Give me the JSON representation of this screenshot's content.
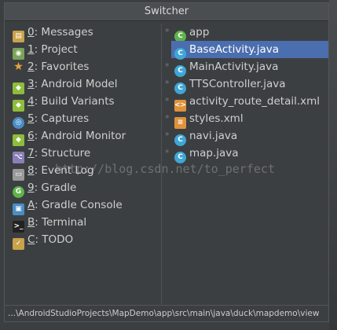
{
  "window": {
    "title": "Switcher"
  },
  "tool_windows": [
    {
      "key": "0",
      "label": ": Messages",
      "icon": "messages-icon",
      "color": "#c9a24a"
    },
    {
      "key": "1",
      "label": ": Project",
      "icon": "project-icon",
      "color": "#7aa35a"
    },
    {
      "key": "2",
      "label": ": Favorites",
      "icon": "star-icon",
      "color": "#e8a33d"
    },
    {
      "key": "3",
      "label": ": Android Model",
      "icon": "android-icon",
      "color": "#8dbd3a"
    },
    {
      "key": "4",
      "label": ": Build Variants",
      "icon": "android-icon",
      "color": "#8dbd3a"
    },
    {
      "key": "5",
      "label": ": Captures",
      "icon": "captures-icon",
      "color": "#4a8dc4"
    },
    {
      "key": "6",
      "label": ": Android Monitor",
      "icon": "android-icon",
      "color": "#8dbd3a"
    },
    {
      "key": "7",
      "label": ": Structure",
      "icon": "structure-icon",
      "color": "#8a7fb8"
    },
    {
      "key": "8",
      "label": ": Event Log",
      "icon": "event-log-icon",
      "color": "#9a9a9a"
    },
    {
      "key": "9",
      "label": ": Gradle",
      "icon": "gradle-icon",
      "color": "#5fb34a"
    },
    {
      "key": "A",
      "label": ": Gradle Console",
      "icon": "gradle-console-icon",
      "color": "#4a8dc4"
    },
    {
      "key": "B",
      "label": ": Terminal",
      "icon": "terminal-icon",
      "color": "#222222"
    },
    {
      "key": "C",
      "label": ": TODO",
      "icon": "todo-icon",
      "color": "#c9a24a"
    }
  ],
  "files": [
    {
      "name": "app",
      "icon": "app-module-icon",
      "color": "#5fb34a"
    },
    {
      "name": "BaseActivity.java",
      "icon": "java-class-icon",
      "color": "#3fa7d6",
      "selected": true
    },
    {
      "name": "MainActivity.java",
      "icon": "java-class-icon",
      "color": "#3fa7d6"
    },
    {
      "name": "TTSController.java",
      "icon": "java-class-icon",
      "color": "#3fa7d6"
    },
    {
      "name": "activity_route_detail.xml",
      "icon": "xml-layout-icon",
      "color": "#e0923a"
    },
    {
      "name": "styles.xml",
      "icon": "xml-values-icon",
      "color": "#e0923a"
    },
    {
      "name": "navi.java",
      "icon": "java-class-icon",
      "color": "#3fa7d6"
    },
    {
      "name": "map.java",
      "icon": "java-class-icon",
      "color": "#3fa7d6"
    }
  ],
  "footer": {
    "path": "...\\AndroidStudioProjects\\MapDemo\\app\\src\\main\\java\\duck\\mapdemo\\view"
  },
  "watermark": "http://blog.csdn.net/to_perfect",
  "colors": {
    "background": "#3c3f41",
    "selection": "#4b6eaf",
    "text": "#cfcfcf"
  }
}
